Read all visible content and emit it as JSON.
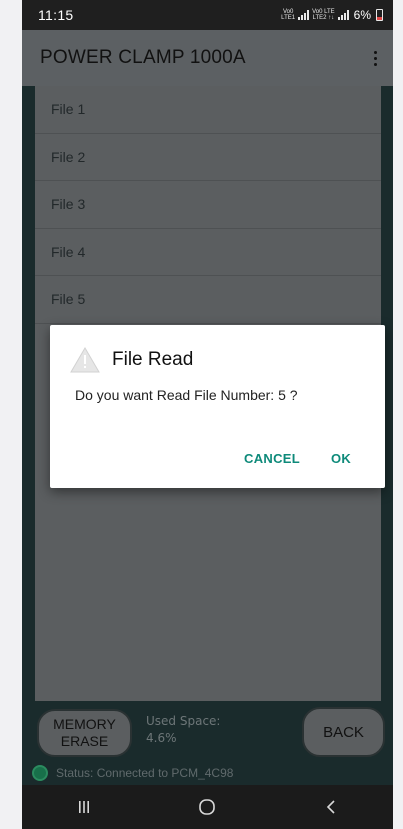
{
  "status_bar": {
    "time": "11:15",
    "net1": "VoLTE1",
    "net2": "VoLTE2",
    "battery": "6%"
  },
  "app_bar": {
    "title": "POWER CLAMP 1000A"
  },
  "files": [
    {
      "label": "File 1"
    },
    {
      "label": "File 2"
    },
    {
      "label": "File 3"
    },
    {
      "label": "File 4"
    },
    {
      "label": "File 5"
    }
  ],
  "bottom": {
    "memory_erase_line1": "MEMORY",
    "memory_erase_line2": "ERASE",
    "used_space_label": "Used Space:",
    "used_space_value": "4.6%",
    "back_label": "BACK",
    "status_text": "Status: Connected to PCM_4C98"
  },
  "dialog": {
    "title": "File Read",
    "message": "Do you want Read File Number: 5 ?",
    "cancel_label": "CANCEL",
    "ok_label": "OK",
    "icon": "warning-icon"
  },
  "colors": {
    "accent": "#0e8a7a",
    "status_connected": "#18704a",
    "warning_icon": "#e0e0e0"
  }
}
